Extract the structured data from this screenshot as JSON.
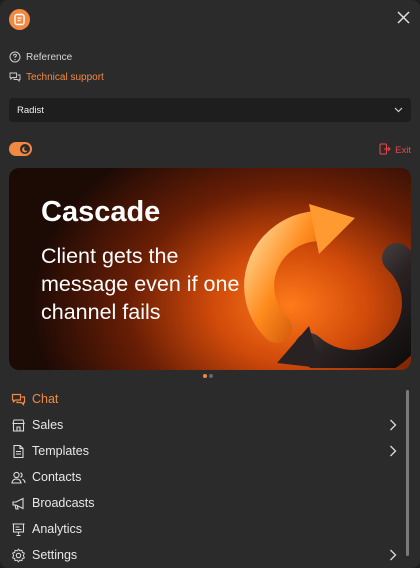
{
  "links": {
    "reference": "Reference",
    "support": "Technical support"
  },
  "account": {
    "selected": "Radist"
  },
  "exit_label": "Exit",
  "banner": {
    "title": "Cascade",
    "subtitle": "Client gets the message even if one channel fails",
    "slide_count": 2,
    "active_slide": 1
  },
  "nav": {
    "chat": "Chat",
    "sales": "Sales",
    "templates": "Templates",
    "contacts": "Contacts",
    "broadcasts": "Broadcasts",
    "analytics": "Analytics",
    "settings": "Settings"
  },
  "colors": {
    "accent": "#f08a43",
    "danger": "#e5484d",
    "background": "#2b2b2b"
  }
}
